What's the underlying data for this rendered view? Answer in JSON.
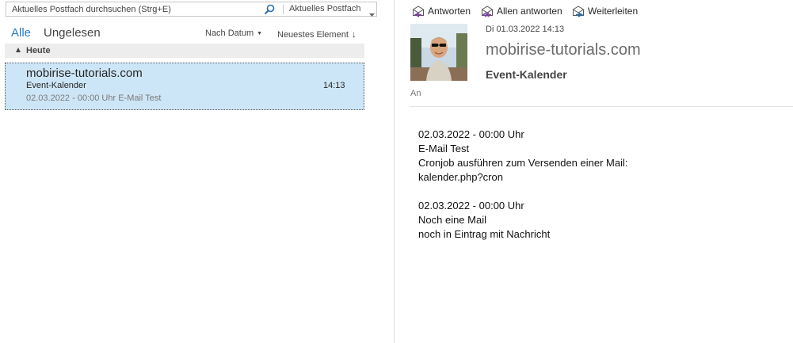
{
  "search": {
    "placeholder": "Aktuelles Postfach durchsuchen (Strg+E)",
    "scope": "Aktuelles Postfach"
  },
  "filters": {
    "all": "Alle",
    "unread": "Ungelesen",
    "sort_by": "Nach Datum",
    "sort_order": "Neuestes Element"
  },
  "group": {
    "label": "Heute"
  },
  "mail_list": [
    {
      "sender": "mobirise-tutorials.com",
      "subject": "Event-Kalender",
      "preview": "02.03.2022 - 00:00 Uhr  E-Mail Test",
      "time": "14:13",
      "selected": true
    }
  ],
  "actions": {
    "reply": "Antworten",
    "reply_all": "Allen antworten",
    "forward": "Weiterleiten"
  },
  "message": {
    "date": "Di 01.03.2022 14:13",
    "sender": "mobirise-tutorials.com",
    "subject": "Event-Kalender",
    "to_label": "An",
    "body": [
      "02.03.2022 - 00:00 Uhr",
      "E-Mail Test",
      "Cronjob ausführen zum Versenden einer Mail:",
      "kalender.php?cron",
      "",
      "02.03.2022 - 00:00 Uhr",
      "Noch eine Mail",
      "noch in Eintrag mit Nachricht"
    ]
  },
  "colors": {
    "accent": "#2b7cbf",
    "selected_bg": "#cde6f7",
    "group_bg": "#ededed"
  },
  "icons": {
    "search": "magnifier-icon",
    "scope": "chevron-down-icon",
    "reply": "reply-icon",
    "reply_all": "reply-all-icon",
    "forward": "forward-icon",
    "group_toggle": "collapse-triangle-icon"
  }
}
